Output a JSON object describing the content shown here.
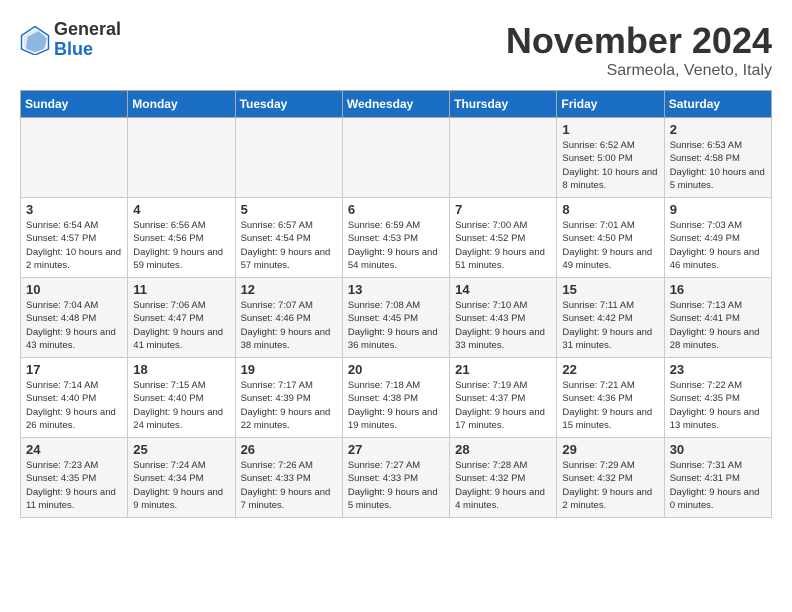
{
  "logo": {
    "general": "General",
    "blue": "Blue"
  },
  "header": {
    "month": "November 2024",
    "location": "Sarmeola, Veneto, Italy"
  },
  "weekdays": [
    "Sunday",
    "Monday",
    "Tuesday",
    "Wednesday",
    "Thursday",
    "Friday",
    "Saturday"
  ],
  "weeks": [
    [
      {
        "day": "",
        "info": ""
      },
      {
        "day": "",
        "info": ""
      },
      {
        "day": "",
        "info": ""
      },
      {
        "day": "",
        "info": ""
      },
      {
        "day": "",
        "info": ""
      },
      {
        "day": "1",
        "info": "Sunrise: 6:52 AM\nSunset: 5:00 PM\nDaylight: 10 hours and 8 minutes."
      },
      {
        "day": "2",
        "info": "Sunrise: 6:53 AM\nSunset: 4:58 PM\nDaylight: 10 hours and 5 minutes."
      }
    ],
    [
      {
        "day": "3",
        "info": "Sunrise: 6:54 AM\nSunset: 4:57 PM\nDaylight: 10 hours and 2 minutes."
      },
      {
        "day": "4",
        "info": "Sunrise: 6:56 AM\nSunset: 4:56 PM\nDaylight: 9 hours and 59 minutes."
      },
      {
        "day": "5",
        "info": "Sunrise: 6:57 AM\nSunset: 4:54 PM\nDaylight: 9 hours and 57 minutes."
      },
      {
        "day": "6",
        "info": "Sunrise: 6:59 AM\nSunset: 4:53 PM\nDaylight: 9 hours and 54 minutes."
      },
      {
        "day": "7",
        "info": "Sunrise: 7:00 AM\nSunset: 4:52 PM\nDaylight: 9 hours and 51 minutes."
      },
      {
        "day": "8",
        "info": "Sunrise: 7:01 AM\nSunset: 4:50 PM\nDaylight: 9 hours and 49 minutes."
      },
      {
        "day": "9",
        "info": "Sunrise: 7:03 AM\nSunset: 4:49 PM\nDaylight: 9 hours and 46 minutes."
      }
    ],
    [
      {
        "day": "10",
        "info": "Sunrise: 7:04 AM\nSunset: 4:48 PM\nDaylight: 9 hours and 43 minutes."
      },
      {
        "day": "11",
        "info": "Sunrise: 7:06 AM\nSunset: 4:47 PM\nDaylight: 9 hours and 41 minutes."
      },
      {
        "day": "12",
        "info": "Sunrise: 7:07 AM\nSunset: 4:46 PM\nDaylight: 9 hours and 38 minutes."
      },
      {
        "day": "13",
        "info": "Sunrise: 7:08 AM\nSunset: 4:45 PM\nDaylight: 9 hours and 36 minutes."
      },
      {
        "day": "14",
        "info": "Sunrise: 7:10 AM\nSunset: 4:43 PM\nDaylight: 9 hours and 33 minutes."
      },
      {
        "day": "15",
        "info": "Sunrise: 7:11 AM\nSunset: 4:42 PM\nDaylight: 9 hours and 31 minutes."
      },
      {
        "day": "16",
        "info": "Sunrise: 7:13 AM\nSunset: 4:41 PM\nDaylight: 9 hours and 28 minutes."
      }
    ],
    [
      {
        "day": "17",
        "info": "Sunrise: 7:14 AM\nSunset: 4:40 PM\nDaylight: 9 hours and 26 minutes."
      },
      {
        "day": "18",
        "info": "Sunrise: 7:15 AM\nSunset: 4:40 PM\nDaylight: 9 hours and 24 minutes."
      },
      {
        "day": "19",
        "info": "Sunrise: 7:17 AM\nSunset: 4:39 PM\nDaylight: 9 hours and 22 minutes."
      },
      {
        "day": "20",
        "info": "Sunrise: 7:18 AM\nSunset: 4:38 PM\nDaylight: 9 hours and 19 minutes."
      },
      {
        "day": "21",
        "info": "Sunrise: 7:19 AM\nSunset: 4:37 PM\nDaylight: 9 hours and 17 minutes."
      },
      {
        "day": "22",
        "info": "Sunrise: 7:21 AM\nSunset: 4:36 PM\nDaylight: 9 hours and 15 minutes."
      },
      {
        "day": "23",
        "info": "Sunrise: 7:22 AM\nSunset: 4:35 PM\nDaylight: 9 hours and 13 minutes."
      }
    ],
    [
      {
        "day": "24",
        "info": "Sunrise: 7:23 AM\nSunset: 4:35 PM\nDaylight: 9 hours and 11 minutes."
      },
      {
        "day": "25",
        "info": "Sunrise: 7:24 AM\nSunset: 4:34 PM\nDaylight: 9 hours and 9 minutes."
      },
      {
        "day": "26",
        "info": "Sunrise: 7:26 AM\nSunset: 4:33 PM\nDaylight: 9 hours and 7 minutes."
      },
      {
        "day": "27",
        "info": "Sunrise: 7:27 AM\nSunset: 4:33 PM\nDaylight: 9 hours and 5 minutes."
      },
      {
        "day": "28",
        "info": "Sunrise: 7:28 AM\nSunset: 4:32 PM\nDaylight: 9 hours and 4 minutes."
      },
      {
        "day": "29",
        "info": "Sunrise: 7:29 AM\nSunset: 4:32 PM\nDaylight: 9 hours and 2 minutes."
      },
      {
        "day": "30",
        "info": "Sunrise: 7:31 AM\nSunset: 4:31 PM\nDaylight: 9 hours and 0 minutes."
      }
    ]
  ]
}
